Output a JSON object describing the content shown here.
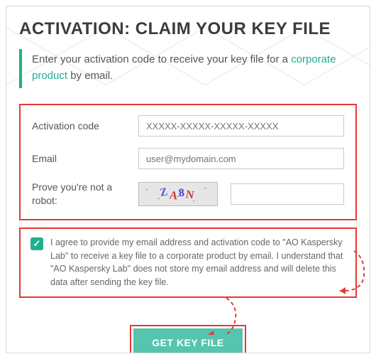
{
  "title": "ACTIVATION: CLAIM YOUR KEY FILE",
  "intro": {
    "prefix": "Enter your activation code to receive your key file for a ",
    "link": "corporate product",
    "suffix": " by email."
  },
  "form": {
    "activation_label": "Activation code",
    "activation_placeholder": "XXXXX-XXXXX-XXXXX-XXXXX",
    "email_label": "Email",
    "email_placeholder": "user@mydomain.com",
    "captcha_label": "Prove you're not a robot:",
    "captcha_glyphs": [
      "Z",
      "A",
      "8",
      "N"
    ]
  },
  "consent": {
    "checked": true,
    "text": "I agree to provide my email address and activation code to \"AO Kaspersky Lab\" to receive a key file to a corporate product by email. I understand that \"AO Kaspersky Lab\" does not store my email address and will delete this data after sending the key file."
  },
  "button": {
    "label": "GET KEY FILE"
  }
}
